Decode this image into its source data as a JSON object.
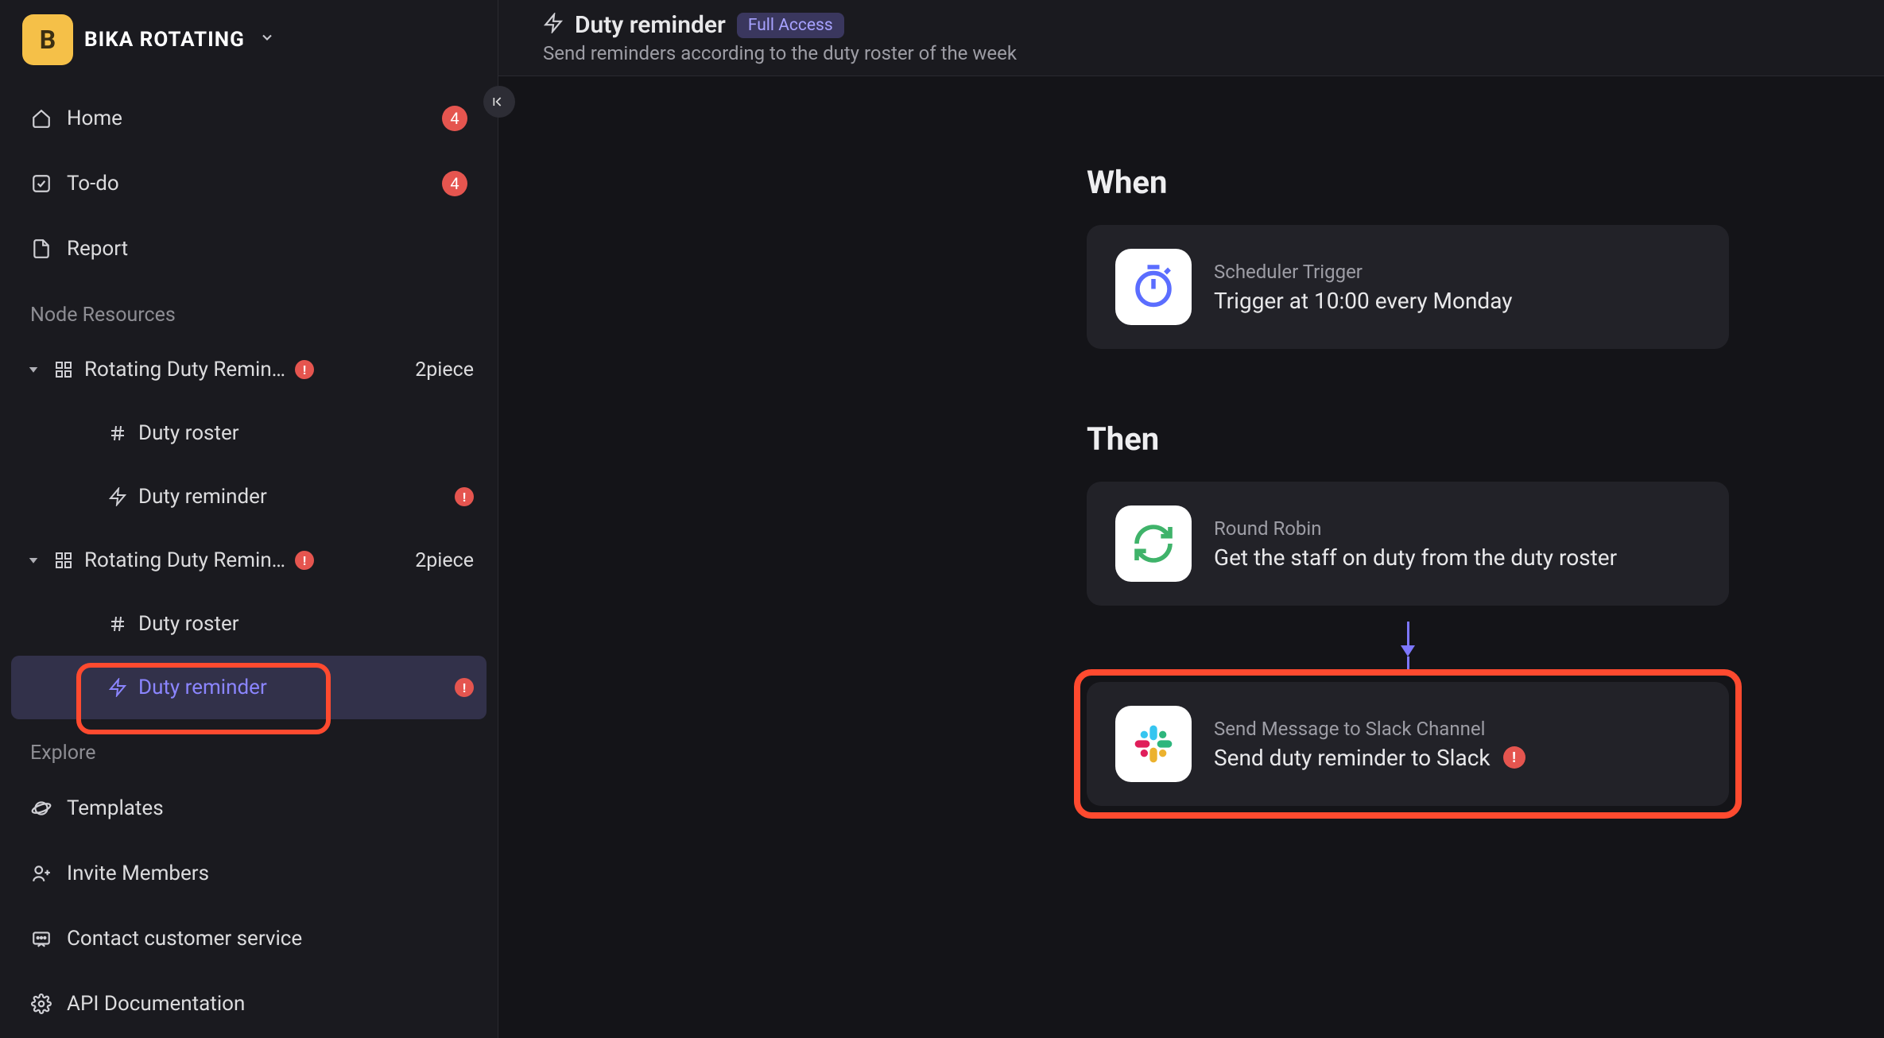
{
  "workspace": {
    "initial": "B",
    "name": "BIKA ROTATING"
  },
  "nav": {
    "home": {
      "label": "Home",
      "badge": "4"
    },
    "todo": {
      "label": "To-do",
      "badge": "4"
    },
    "report": {
      "label": "Report"
    }
  },
  "sections": {
    "resources": "Node Resources",
    "explore": "Explore"
  },
  "tree": {
    "group1": {
      "name": "Rotating Duty Remin…",
      "count": "2piece"
    },
    "group1_child1": {
      "name": "Duty roster"
    },
    "group1_child2": {
      "name": "Duty reminder"
    },
    "group2": {
      "name": "Rotating Duty Remin…",
      "count": "2piece"
    },
    "group2_child1": {
      "name": "Duty roster"
    },
    "group2_child2": {
      "name": "Duty reminder"
    }
  },
  "explore": {
    "templates": "Templates",
    "invite": "Invite Members",
    "contact": "Contact customer service",
    "api": "API Documentation"
  },
  "header": {
    "title": "Duty reminder",
    "chip": "Full Access",
    "subtitle": "Send reminders according to the duty roster of the week"
  },
  "flow": {
    "when": "When",
    "then": "Then",
    "trigger": {
      "label": "Scheduler Trigger",
      "title": "Trigger at 10:00 every Monday"
    },
    "step1": {
      "label": "Round Robin",
      "title": "Get the staff on duty from the duty roster"
    },
    "step2": {
      "label": "Send Message to Slack Channel",
      "title": "Send duty reminder to Slack"
    }
  }
}
